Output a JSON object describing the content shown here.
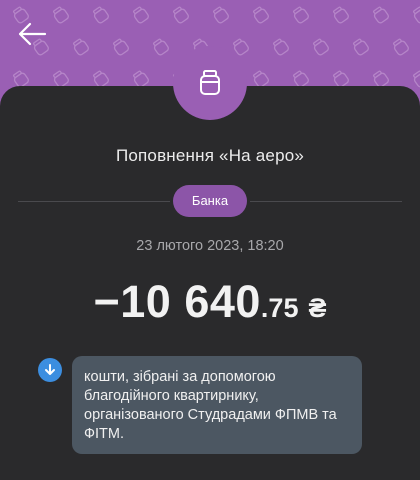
{
  "header": {
    "back_icon": "arrow-left-icon",
    "pattern_icon": "jar-icon",
    "accent_color": "#9a5fb4"
  },
  "transaction": {
    "avatar_icon": "jar-icon",
    "title": "Поповнення «На аеро»",
    "category": "Банка",
    "datetime": "23 лютого 2023, 18:20",
    "amount_integer": "−10 640",
    "amount_fraction": ".75",
    "currency": "₴"
  },
  "comment": {
    "icon": "arrow-down-circle-icon",
    "text": "кошти, зібрані за допомогою благодійного квартирнику, організованого Студрадами ФПМВ та ФІТМ."
  }
}
